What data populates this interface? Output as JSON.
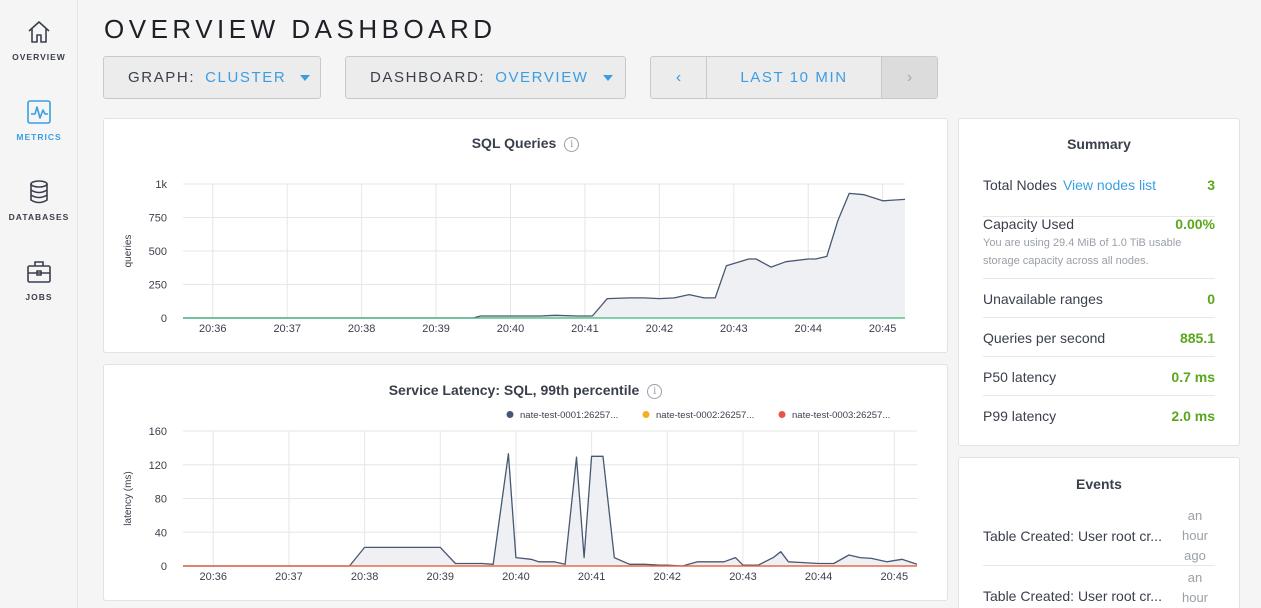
{
  "sidebar": {
    "items": [
      {
        "label": "OVERVIEW",
        "icon": "home-icon"
      },
      {
        "label": "METRICS",
        "icon": "metrics-icon"
      },
      {
        "label": "DATABASES",
        "icon": "database-icon"
      },
      {
        "label": "JOBS",
        "icon": "briefcase-icon"
      }
    ],
    "active": "METRICS"
  },
  "header": {
    "title": "OVERVIEW DASHBOARD",
    "graph_label": "GRAPH:",
    "graph_value": "CLUSTER",
    "dashboard_label": "DASHBOARD:",
    "dashboard_value": "OVERVIEW",
    "time_range": "LAST 10 MIN",
    "prev_glyph": "‹",
    "next_glyph": "›"
  },
  "colors": {
    "accent": "#3a9ee3",
    "green_value": "#5aa61c",
    "series_1": "#475872",
    "series_2": "#f2b01e",
    "series_3": "#e8564a",
    "green_series": "#3cb878"
  },
  "chart_data": [
    {
      "type": "area",
      "title": "SQL Queries",
      "ylabel": "queries",
      "xlabel": "",
      "x_ticks": [
        "20:36",
        "20:37",
        "20:38",
        "20:39",
        "20:40",
        "20:41",
        "20:42",
        "20:43",
        "20:44",
        "20:45"
      ],
      "y_ticks": [
        "0",
        "250",
        "500",
        "750",
        "1k"
      ],
      "ylim": [
        0,
        1000
      ],
      "xlim": [
        35.6,
        45.3
      ],
      "grid": true,
      "series": [
        {
          "name": "",
          "color": "#475872",
          "x": [
            35.6,
            39.5,
            39.6,
            40.2,
            40.4,
            40.6,
            40.9,
            41.1,
            41.3,
            41.6,
            41.8,
            42.0,
            42.2,
            42.4,
            42.6,
            42.75,
            42.9,
            43.2,
            43.3,
            43.5,
            43.7,
            44.0,
            44.1,
            44.25,
            44.4,
            44.55,
            44.75,
            45.0,
            45.3
          ],
          "y": [
            0,
            0,
            15,
            15,
            15,
            20,
            15,
            15,
            145,
            150,
            150,
            145,
            150,
            175,
            150,
            150,
            390,
            440,
            440,
            380,
            420,
            440,
            440,
            460,
            730,
            930,
            920,
            875,
            885
          ]
        },
        {
          "name": "",
          "color": "#3cb878",
          "x": [
            35.6,
            45.3
          ],
          "y": [
            0,
            0
          ]
        }
      ]
    },
    {
      "type": "area",
      "title": "Service Latency: SQL, 99th percentile",
      "ylabel": "latency (ms)",
      "xlabel": "",
      "x_ticks": [
        "20:36",
        "20:37",
        "20:38",
        "20:39",
        "20:40",
        "20:41",
        "20:42",
        "20:43",
        "20:44",
        "20:45"
      ],
      "y_ticks": [
        "0",
        "40",
        "80",
        "120",
        "160"
      ],
      "ylim": [
        0,
        160
      ],
      "xlim": [
        35.6,
        45.3
      ],
      "grid": true,
      "legend": "top-right",
      "series": [
        {
          "name": "nate-test-0001:26257...",
          "color": "#475872",
          "x": [
            35.6,
            37.5,
            37.8,
            38.0,
            38.2,
            38.4,
            38.5,
            38.75,
            38.8,
            39.0,
            39.2,
            39.3,
            39.55,
            39.7,
            39.9,
            40.0,
            40.2,
            40.3,
            40.5,
            40.65,
            40.8,
            40.9,
            41.0,
            41.15,
            41.3,
            41.5,
            41.7,
            41.9,
            42.0,
            42.2,
            42.4,
            42.6,
            42.75,
            42.9,
            43.0,
            43.2,
            43.4,
            43.5,
            43.6,
            43.8,
            44.0,
            44.2,
            44.4,
            44.55,
            44.7,
            44.9,
            45.1,
            45.3
          ],
          "y": [
            0,
            0,
            0,
            22,
            22,
            22,
            22,
            22,
            22,
            22,
            3,
            3,
            3,
            2,
            133,
            10,
            8,
            5,
            5,
            2,
            129,
            10,
            130,
            130,
            10,
            2,
            2,
            1,
            1,
            0,
            5,
            5,
            5,
            10,
            1,
            1,
            10,
            17,
            5,
            4,
            3,
            3,
            13,
            10,
            9,
            5,
            8,
            2
          ]
        },
        {
          "name": "nate-test-0002:26257...",
          "color": "#f2b01e",
          "x": [
            35.6,
            45.3
          ],
          "y": [
            0,
            0
          ]
        },
        {
          "name": "nate-test-0003:26257...",
          "color": "#e8564a",
          "x": [
            35.6,
            45.3
          ],
          "y": [
            0,
            0
          ]
        }
      ]
    }
  ],
  "summary": {
    "title": "Summary",
    "rows": [
      {
        "label": "Total Nodes",
        "link": "View nodes list",
        "value": "3"
      },
      {
        "label": "Capacity Used",
        "value": "0.00%",
        "sub": "You are using 29.4 MiB of 1.0 TiB usable storage capacity across all nodes."
      },
      {
        "label": "Unavailable ranges",
        "value": "0"
      },
      {
        "label": "Queries per second",
        "value": "885.1"
      },
      {
        "label": "P50 latency",
        "value": "0.7 ms"
      },
      {
        "label": "P99 latency",
        "value": "2.0 ms"
      }
    ]
  },
  "events": {
    "title": "Events",
    "items": [
      {
        "text": "Table Created: User root cr...",
        "time": "an hour ago"
      },
      {
        "text": "Table Created: User root cr...",
        "time": "an hour"
      }
    ]
  }
}
